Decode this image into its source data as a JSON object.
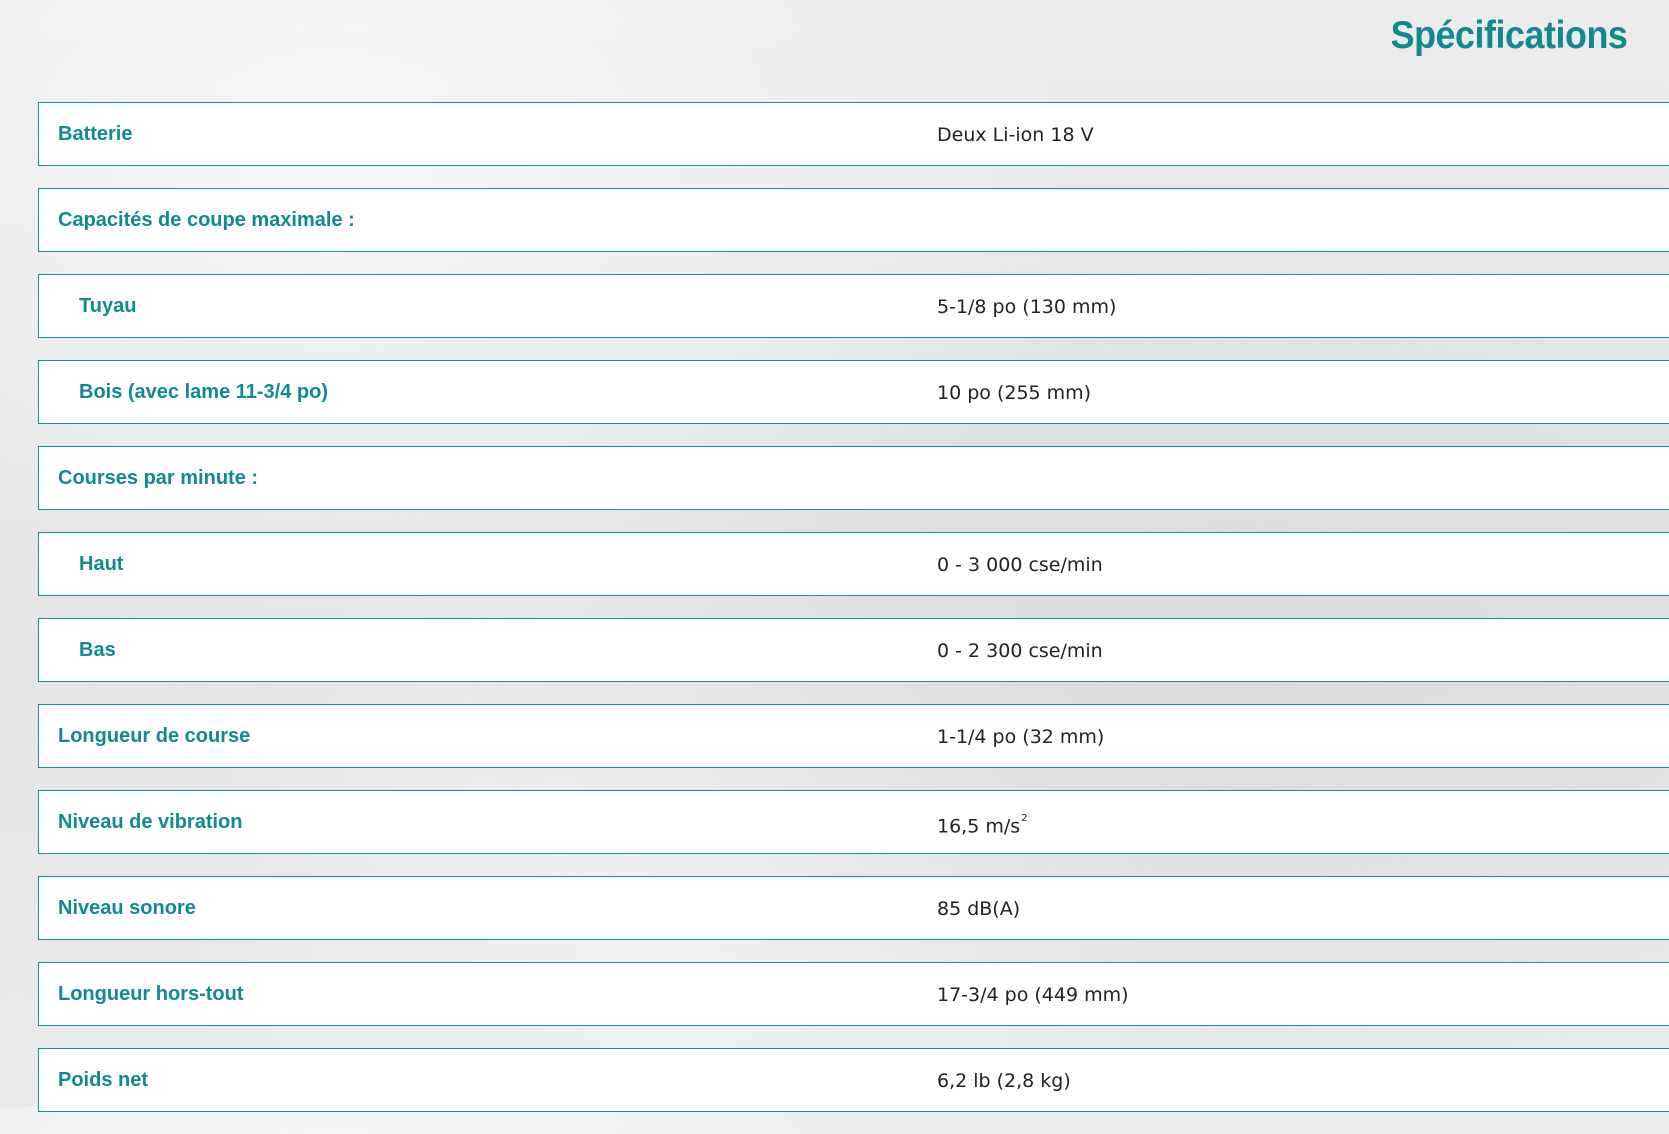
{
  "heading": "Spécifications",
  "accent_color": "#108a90",
  "rows": [
    {
      "label": "Batterie",
      "value": "Deux Li-ion 18 V"
    },
    {
      "label": "Capacités de coupe maximale :",
      "value": ""
    },
    {
      "label": "Tuyau",
      "value": "5-1/8 po (130 mm)"
    },
    {
      "label": "Bois (avec lame 11-3/4 po)",
      "value": "10 po (255 mm)"
    },
    {
      "label": "Courses par minute :",
      "value": ""
    },
    {
      "label": "Haut",
      "value": "0 - 3 000 cse/min"
    },
    {
      "label": "Bas",
      "value": "0 - 2 300 cse/min"
    },
    {
      "label": "Longueur de course",
      "value": "1-1/4 po (32 mm)"
    },
    {
      "label": "Niveau de vibration",
      "value": "16,5 m/s",
      "value_superscript": "2"
    },
    {
      "label": "Niveau sonore",
      "value": "85 dB(A)"
    },
    {
      "label": "Longueur hors-tout",
      "value": "17-3/4 po (449 mm)"
    },
    {
      "label": "Poids net",
      "value": "6,2 lb (2,8 kg)"
    }
  ]
}
